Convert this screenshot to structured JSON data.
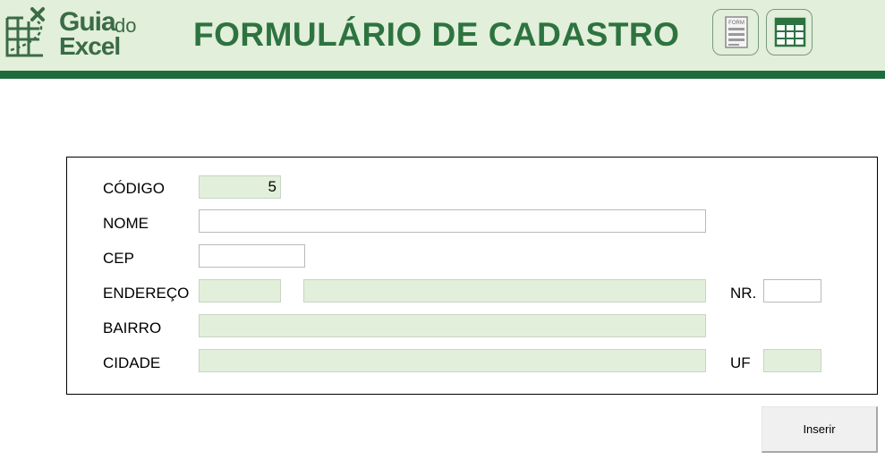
{
  "header": {
    "logo": {
      "word1": "Guia",
      "word2": "do",
      "word3": "Excel"
    },
    "title": "FORMULÁRIO DE CADASTRO",
    "form_icon_text": "FORM",
    "colors": {
      "header_bg": "#e2efda",
      "accent": "#1e6b3c",
      "title": "#2d7340"
    }
  },
  "form": {
    "codigo": {
      "label": "CÓDIGO",
      "value": "5"
    },
    "nome": {
      "label": "NOME",
      "value": ""
    },
    "cep": {
      "label": "CEP",
      "value": ""
    },
    "endereco": {
      "label": "ENDEREÇO",
      "tipo_value": "",
      "value": ""
    },
    "numero": {
      "label": "NR.",
      "value": ""
    },
    "bairro": {
      "label": "BAIRRO",
      "value": ""
    },
    "cidade": {
      "label": "CIDADE",
      "value": ""
    },
    "uf": {
      "label": "UF",
      "value": ""
    }
  },
  "actions": {
    "insert_label": "Inserir"
  }
}
